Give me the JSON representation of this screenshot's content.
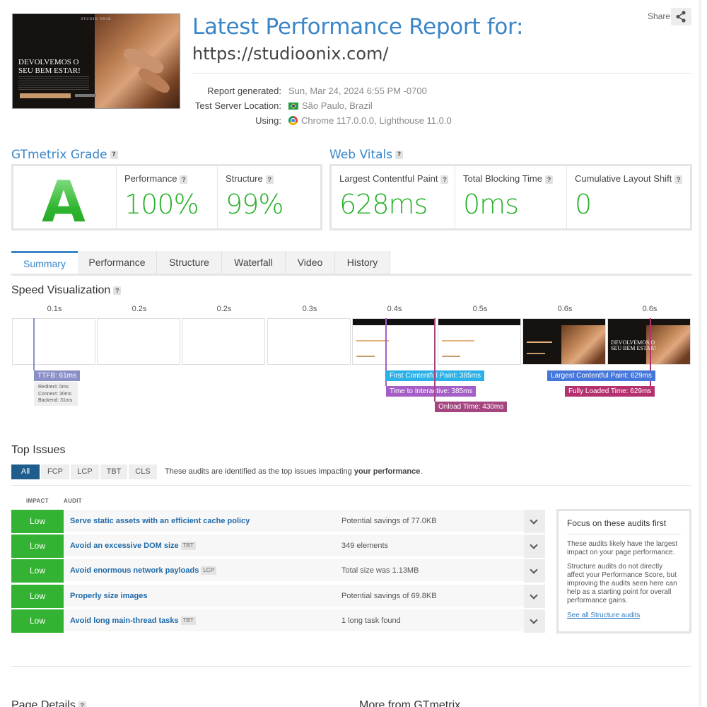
{
  "header": {
    "title": "Latest Performance Report for:",
    "url": "https://studioonix.com/",
    "share_label": "Share",
    "thumbnail": {
      "brand": "STUDIO ONIX",
      "headline_line1": "DEVOLVEMOS O",
      "headline_line2": "SEU BEM ESTAR!"
    },
    "meta": [
      {
        "label": "Report generated:",
        "value": "Sun, Mar 24, 2024 6:55 PM -0700",
        "icon": ""
      },
      {
        "label": "Test Server Location:",
        "value": "São Paulo, Brazil",
        "icon": "brazil-flag-icon"
      },
      {
        "label": "Using:",
        "value": "Chrome 117.0.0.0, Lighthouse 11.0.0",
        "icon": "chrome-icon"
      }
    ]
  },
  "grade": {
    "title": "GTmetrix Grade",
    "letter": "A",
    "performance_label": "Performance",
    "performance_value": "100%",
    "structure_label": "Structure",
    "structure_value": "99%"
  },
  "vitals": {
    "title": "Web Vitals",
    "lcp_label": "Largest Contentful Paint",
    "lcp_value": "628ms",
    "tbt_label": "Total Blocking Time",
    "tbt_value": "0ms",
    "cls_label": "Cumulative Layout Shift",
    "cls_value": "0"
  },
  "tabs": [
    "Summary",
    "Performance",
    "Structure",
    "Waterfall",
    "Video",
    "History"
  ],
  "speed": {
    "title": "Speed Visualization",
    "times": [
      "0.1s",
      "0.2s",
      "0.2s",
      "0.3s",
      "0.4s",
      "0.5s",
      "0.6s",
      "0.6s"
    ],
    "markers": {
      "ttfb": "TTFB: 61ms",
      "ttfb_detail": [
        "Redirect: 0ms",
        "Connect: 30ms",
        "Backend: 31ms"
      ],
      "fcp": "First Contentful Paint: 385ms",
      "tti": "Time to Interactive: 385ms",
      "onload": "Onload Time: 430ms",
      "lcp": "Largest Contentful Paint: 629ms",
      "fully": "Fully Loaded Time: 629ms"
    },
    "colors": {
      "ttfb": "#8a90c6",
      "fcp": "#2ab1e8",
      "tti": "#a55ec7",
      "onload": "#a4457f",
      "lcp": "#4576d9",
      "fully": "#b5306e"
    }
  },
  "issues": {
    "title": "Top Issues",
    "filters": [
      "All",
      "FCP",
      "LCP",
      "TBT",
      "CLS"
    ],
    "note_prefix": "These audits are identified as the top issues impacting ",
    "note_bold": "your performance",
    "note_suffix": ".",
    "col_impact": "IMPACT",
    "col_audit": "AUDIT",
    "rows": [
      {
        "impact": "Low",
        "audit": "Serve static assets with an efficient cache policy",
        "tag": "",
        "savings": "Potential savings of 77.0KB"
      },
      {
        "impact": "Low",
        "audit": "Avoid an excessive DOM size",
        "tag": "TBT",
        "savings": "349 elements"
      },
      {
        "impact": "Low",
        "audit": "Avoid enormous network payloads",
        "tag": "LCP",
        "savings": "Total size was 1.13MB"
      },
      {
        "impact": "Low",
        "audit": "Properly size images",
        "tag": "",
        "savings": "Potential savings of 69.8KB"
      },
      {
        "impact": "Low",
        "audit": "Avoid long main-thread tasks",
        "tag": "TBT",
        "savings": "1 long task found"
      }
    ],
    "focus": {
      "heading": "Focus on these audits first",
      "p1": "These audits likely have the largest impact on your page performance.",
      "p2": "Structure audits do not directly affect your Performance Score, but improving the audits seen here can help as a starting point for overall performance gains.",
      "link": "See all Structure audits"
    }
  },
  "footer": {
    "page_details": "Page Details",
    "more": "More from GTmetrix"
  }
}
